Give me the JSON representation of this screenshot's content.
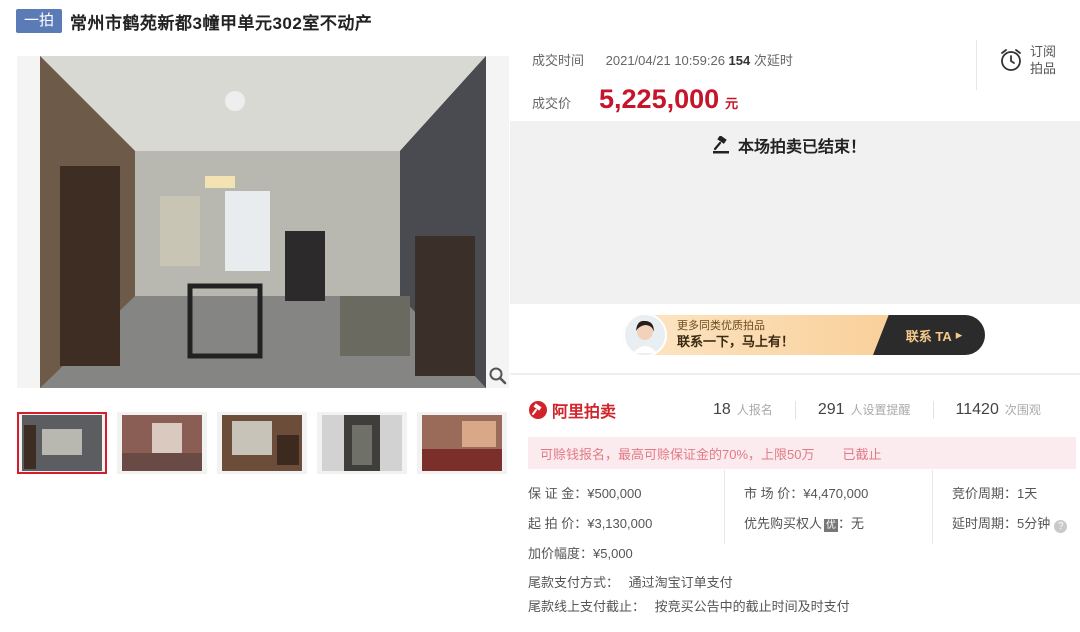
{
  "header": {
    "round": "一拍",
    "title": "常州市鹤苑新都3幢甲单元302室不动产"
  },
  "deal": {
    "time_label": "成交时间",
    "time_value": "2021/04/21 10:59:26",
    "delay_count": "154",
    "delay_unit": "次延时",
    "price_label": "成交价",
    "price_value": "5,225,000",
    "price_unit": "元"
  },
  "subscribe": {
    "line1": "订阅",
    "line2": "拍品",
    "icon": "alarm-clock-icon"
  },
  "status": {
    "ended_text": "本场拍卖已结束！",
    "icon": "gavel-icon"
  },
  "promo": {
    "small": "更多同类优质拍品",
    "big": "联系一下，马上有！",
    "cta": "联系 TA"
  },
  "stats": {
    "logo": "阿里拍卖",
    "signups": "18",
    "signups_label": "人报名",
    "reminders": "291",
    "reminders_label": "人设置提醒",
    "views": "11420",
    "views_label": "次围观"
  },
  "notice": {
    "text": "可赊钱报名，最高可赊保证金的70%，上限50万",
    "status": "已截止"
  },
  "details": {
    "deposit_label": "保 证 金：",
    "deposit_value": "¥500,000",
    "market_label": "市 场 价：",
    "market_value": "¥4,470,000",
    "bid_period_label": "竞价周期：",
    "bid_period_value": "1天",
    "start_label": "起 拍 价：",
    "start_value": "¥3,130,000",
    "priority_label": "优先购买权人",
    "priority_badge": "优",
    "priority_value": "：无",
    "extend_label": "延时周期：",
    "extend_value": "5分钟",
    "increment_label": "加价幅度：",
    "increment_value": "¥5,000",
    "payment_label": "尾款支付方式：",
    "payment_value": "通过淘宝订单支付",
    "deadline_label": "尾款线上支付截止：",
    "deadline_value": "按竞买公告中的截止时间及时支付"
  },
  "colors": {
    "accent": "#c6142b",
    "badge": "#5a7bb5",
    "notice_bg": "#fcebee"
  }
}
